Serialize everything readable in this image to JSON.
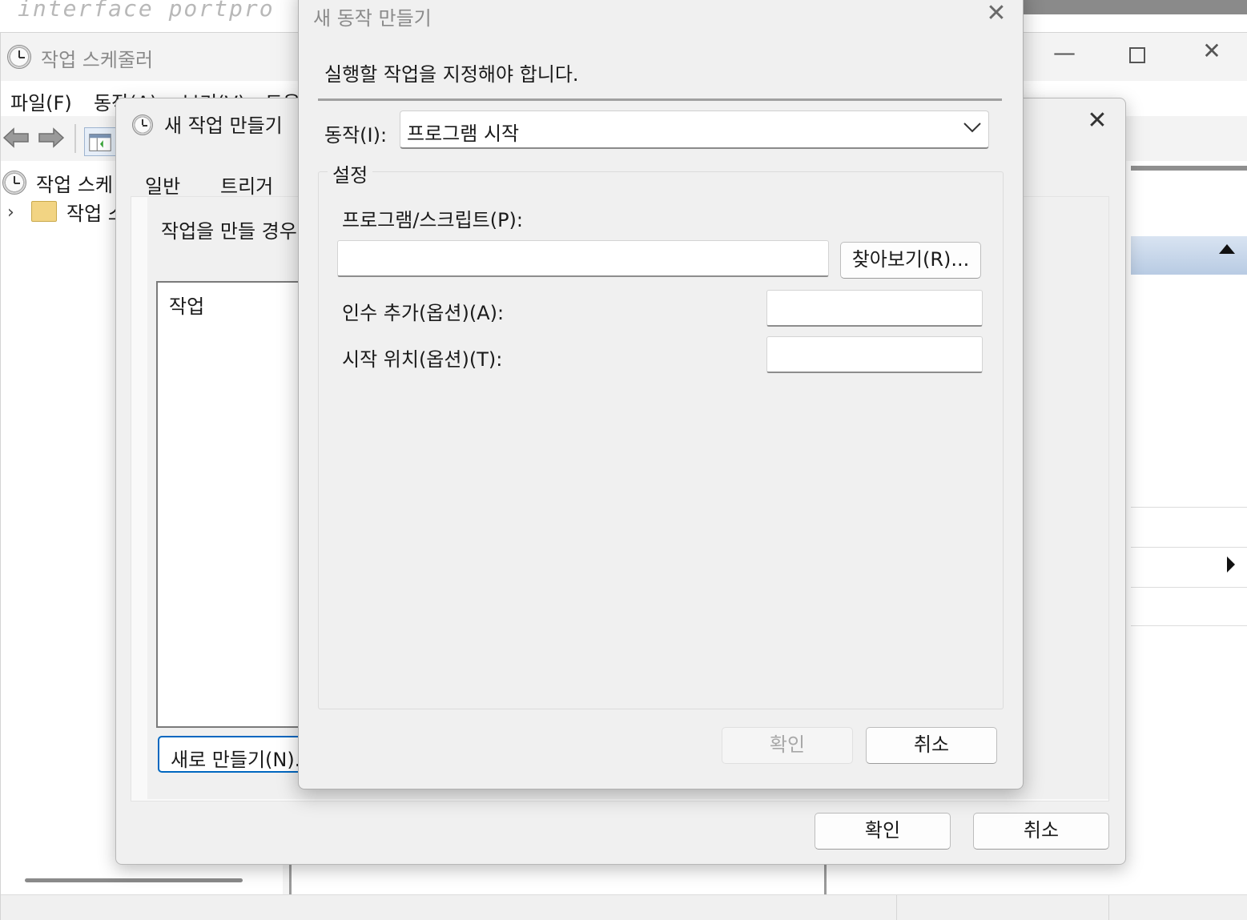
{
  "background": {
    "editor_text": "interface portpro"
  },
  "main_window": {
    "title": "작업 스케줄러",
    "menu": [
      {
        "label": "파일(F)"
      },
      {
        "label": "동작(A)"
      },
      {
        "label": "보기(V)"
      },
      {
        "label": "도움"
      }
    ],
    "tree": {
      "root_label": "작업 스케",
      "child_label": "작업 스"
    }
  },
  "create_task_dialog": {
    "title": "새 작업 만들기",
    "tabs": [
      {
        "label": "일반"
      },
      {
        "label": "트리거"
      }
    ],
    "description": "작업을 만들 경우",
    "list_header": "작업",
    "new_button": "새로 만들기(N)...",
    "ok_button": "확인",
    "cancel_button": "취소"
  },
  "new_action_dialog": {
    "title": "새 동작 만들기",
    "instruction": "실행할 작업을 지정해야 합니다.",
    "action_label": "동작(I):",
    "action_value": "프로그램 시작",
    "settings_legend": "설정",
    "program_label": "프로그램/스크립트(P):",
    "program_value": "",
    "browse_button": "찾아보기(R)...",
    "args_label": "인수 추가(옵션)(A):",
    "args_value": "",
    "start_in_label": "시작 위치(옵션)(T):",
    "start_in_value": "",
    "ok_button": "확인",
    "ok_enabled": false,
    "cancel_button": "취소"
  }
}
